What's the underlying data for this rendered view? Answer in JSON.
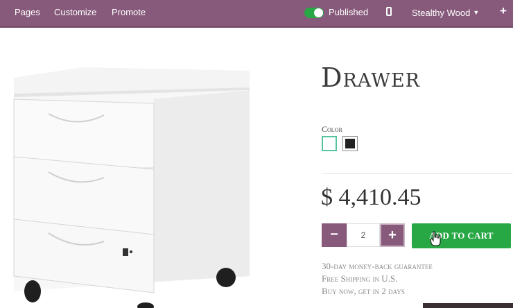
{
  "topbar": {
    "menu": [
      "Pages",
      "Customize",
      "Promote"
    ],
    "publish_label": "Published",
    "published": true,
    "website_label": "Stealthy Wood",
    "icons": [
      "toggle-switch",
      "mobile-phone-icon",
      "chevron-down-icon",
      "plus-icon"
    ]
  },
  "product": {
    "name": "Drawer",
    "attribute_label": "Color",
    "swatches": [
      "white",
      "black"
    ],
    "selected_swatch": "white",
    "price": "$ 4,410.45",
    "quantity": "2",
    "add_to_cart_label": "ADD TO CART",
    "terms": [
      "30-day money-back guarantee",
      "Free Shipping in U.S.",
      "Buy now, get in 2 days"
    ]
  },
  "colors": {
    "brand": "#875a7b",
    "success": "#28a745",
    "swatch_selected_border": "#56c59e"
  }
}
